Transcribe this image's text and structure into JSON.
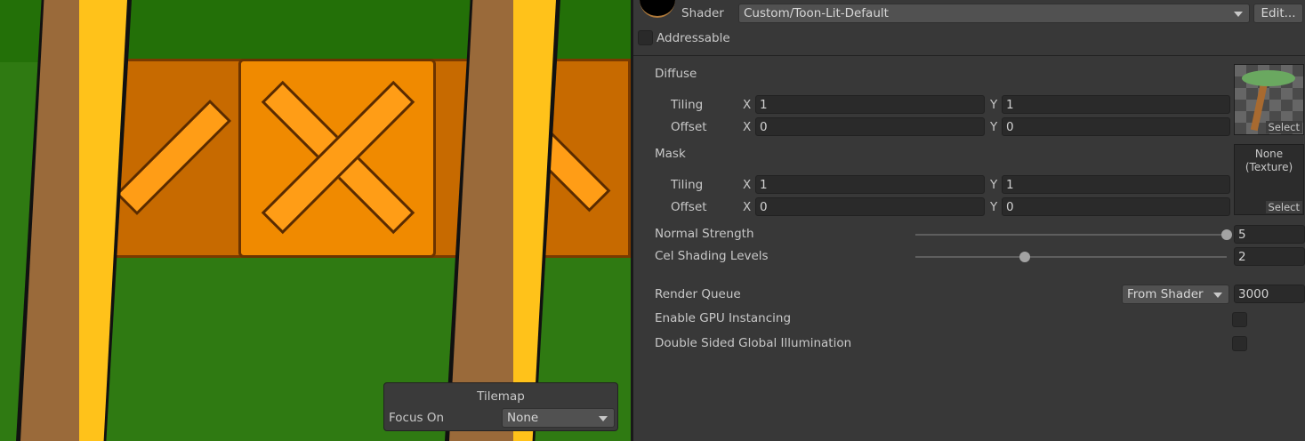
{
  "shader": {
    "label": "Shader",
    "value": "Custom/Toon-Lit-Default",
    "edit_label": "Edit..."
  },
  "addressable": {
    "label": "Addressable",
    "checked": false
  },
  "diffuse": {
    "title": "Diffuse",
    "tiling_label": "Tiling",
    "offset_label": "Offset",
    "tiling_x": "1",
    "tiling_y": "1",
    "offset_x": "0",
    "offset_y": "0",
    "select_label": "Select"
  },
  "mask": {
    "title": "Mask",
    "tiling_label": "Tiling",
    "offset_label": "Offset",
    "tiling_x": "1",
    "tiling_y": "1",
    "offset_x": "0",
    "offset_y": "0",
    "texture": "None\n(Texture)",
    "select_label": "Select"
  },
  "axis": {
    "x": "X",
    "y": "Y"
  },
  "normal_strength": {
    "label": "Normal Strength",
    "value": "5",
    "fraction": 1.0
  },
  "cel_shading": {
    "label": "Cel Shading Levels",
    "value": "2",
    "fraction": 0.35
  },
  "render_queue": {
    "label": "Render Queue",
    "mode": "From Shader",
    "value": "3000"
  },
  "gpu_instancing": {
    "label": "Enable GPU Instancing",
    "checked": false
  },
  "double_sided_gi": {
    "label": "Double Sided Global Illumination",
    "checked": false
  },
  "tilemap_overlay": {
    "title": "Tilemap",
    "focus_label": "Focus On",
    "focus_value": "None"
  }
}
